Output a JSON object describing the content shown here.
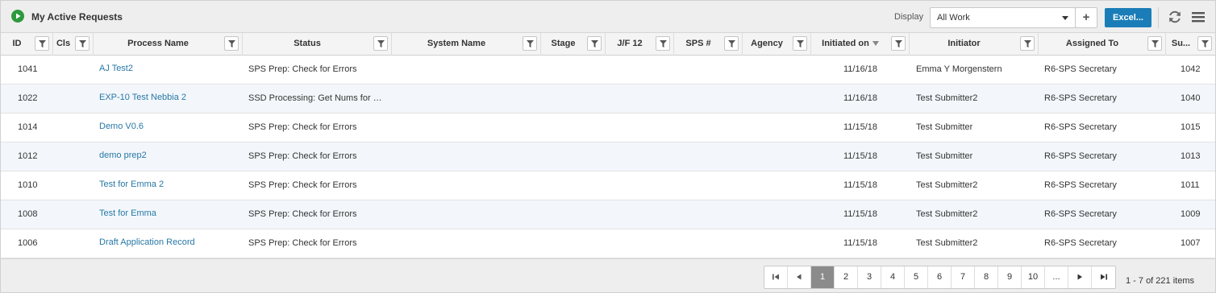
{
  "header": {
    "title": "My Active Requests",
    "display_label": "Display",
    "display_value": "All Work",
    "add_label": "+",
    "excel_label": "Excel..."
  },
  "columns": [
    {
      "label": "ID"
    },
    {
      "label": "Cls"
    },
    {
      "label": "Process Name"
    },
    {
      "label": "Status"
    },
    {
      "label": "System Name"
    },
    {
      "label": "Stage"
    },
    {
      "label": "J/F 12"
    },
    {
      "label": "SPS #"
    },
    {
      "label": "Agency"
    },
    {
      "label": "Initiated on"
    },
    {
      "label": "Initiator"
    },
    {
      "label": "Assigned To"
    },
    {
      "label": "Su..."
    }
  ],
  "rows": [
    {
      "id": "1041",
      "process": "AJ Test2",
      "status": "SPS Prep: Check for Errors",
      "initiated": "11/16/18",
      "initiator": "Emma Y Morgenstern",
      "assigned": "R6-SPS Secretary",
      "su": "1042"
    },
    {
      "id": "1022",
      "process": "EXP-10 Test Nebbia 2",
      "status": "SSD Processing: Get Nums for …",
      "initiated": "11/16/18",
      "initiator": "Test Submitter2",
      "assigned": "R6-SPS Secretary",
      "su": "1040"
    },
    {
      "id": "1014",
      "process": "Demo V0.6",
      "status": "SPS Prep: Check for Errors",
      "initiated": "11/15/18",
      "initiator": "Test Submitter",
      "assigned": "R6-SPS Secretary",
      "su": "1015"
    },
    {
      "id": "1012",
      "process": "demo prep2",
      "status": "SPS Prep: Check for Errors",
      "initiated": "11/15/18",
      "initiator": "Test Submitter",
      "assigned": "R6-SPS Secretary",
      "su": "1013"
    },
    {
      "id": "1010",
      "process": "Test for Emma 2",
      "status": "SPS Prep: Check for Errors",
      "initiated": "11/15/18",
      "initiator": "Test Submitter2",
      "assigned": "R6-SPS Secretary",
      "su": "1011"
    },
    {
      "id": "1008",
      "process": "Test for Emma",
      "status": "SPS Prep: Check for Errors",
      "initiated": "11/15/18",
      "initiator": "Test Submitter2",
      "assigned": "R6-SPS Secretary",
      "su": "1009"
    },
    {
      "id": "1006",
      "process": "Draft Application Record",
      "status": "SPS Prep: Check for Errors",
      "initiated": "11/15/18",
      "initiator": "Test Submitter2",
      "assigned": "R6-SPS Secretary",
      "su": "1007"
    }
  ],
  "pager": {
    "pages": [
      "1",
      "2",
      "3",
      "4",
      "5",
      "6",
      "7",
      "8",
      "9",
      "10",
      "..."
    ],
    "current": "1",
    "summary": "1 - 7 of 221 items"
  },
  "colors": {
    "accent": "#1a7db8",
    "link": "#2778a6",
    "play": "#2e9a3e",
    "active_page": "#8b8b8b"
  },
  "icons": {
    "play": "play-circle-icon",
    "caret": "chevron-down-icon",
    "refresh": "refresh-icon",
    "menu": "hamburger-menu-icon",
    "filter": "filter-icon",
    "sort": "sort-desc-icon"
  }
}
